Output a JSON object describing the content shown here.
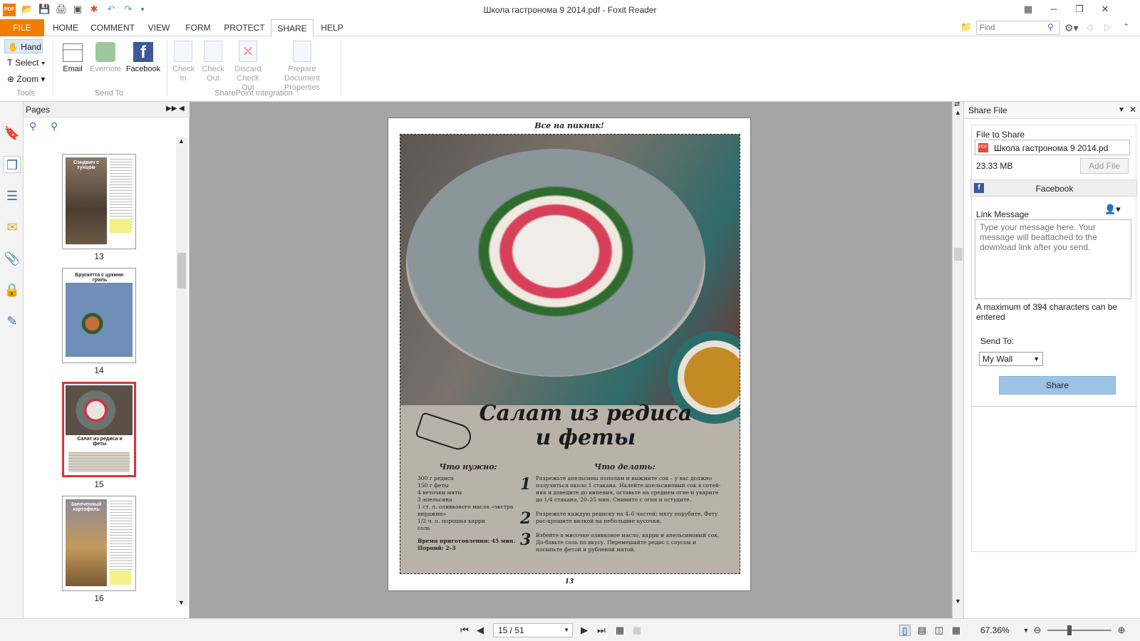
{
  "window": {
    "title": "Школа гастронома 9 2014.pdf - Foxit Reader",
    "app_icon_text": "PDF"
  },
  "menu": {
    "items": [
      "FILE",
      "HOME",
      "COMMENT",
      "VIEW",
      "FORM",
      "PROTECT",
      "SHARE",
      "HELP"
    ],
    "active": "SHARE",
    "find_placeholder": "Find"
  },
  "ribbon": {
    "tools": {
      "hand": "Hand",
      "select": "Select",
      "zoom": "Zoom",
      "group": "Tools"
    },
    "send_to": {
      "email": "Email",
      "evernote": "Evernote",
      "facebook": "Facebook",
      "group": "Send To"
    },
    "sharepoint": {
      "check_in": "Check In",
      "check_out": "Check Out",
      "discard": "Discard Check Out",
      "prepare": "Prepare Document Properties",
      "group": "SharePoint Integration"
    }
  },
  "pages_panel": {
    "title": "Pages",
    "thumbnails": [
      {
        "num": "13",
        "heading": "Сэндвич с тунцом",
        "color": "#5a4a3a"
      },
      {
        "num": "14",
        "heading": "Брускетта с цукини-гриль",
        "color": "#6f8fb8"
      },
      {
        "num": "15",
        "heading": "Салат из редиса и феты",
        "color": "#5f6a62"
      },
      {
        "num": "16",
        "heading": "Запеченный картофель",
        "color": "#9c7f5a"
      }
    ],
    "current": "15"
  },
  "document": {
    "header": "Все на пикник!",
    "title_line1": "Салат из редиса",
    "title_line2": "и феты",
    "ingredients_heading": "Что нужно:",
    "ingredients": [
      "300 г редиса",
      "150 г феты",
      "4 веточки мяты",
      "3 апельсина",
      "1 ст. л. оливкового масла «экстра",
      "вирджин»",
      "1/2 ч. л. порошка карри",
      "соль"
    ],
    "time": "Время приготовления: 45 мин.",
    "portions": "Порций: 2–3",
    "steps_heading": "Что делать:",
    "steps": [
      {
        "n": "1",
        "text": "Разрежьте апельсины пополам и выжмите сок – у вас должно получиться около 1 стакана. Налейте апельсиновый сок в сотей-ник и доведите до кипения, оставьте на среднем огне и уварите до 1/4 стакана, 20–25 мин. Снимите с огня и остудите."
      },
      {
        "n": "2",
        "text": "Разрежьте каждую редиску на 4–6 частей; мяту порубите. Фету рас-крошите вилкой на небольшие кусочки."
      },
      {
        "n": "3",
        "text": "Взбейте в мисочке оливковое масло, карри и апельсиновый сок. До-бавьте соль по вкусу. Перемешайте редис с соусом и посыпьте фетой и рубленой мятой."
      }
    ],
    "page_number": "13"
  },
  "share_panel": {
    "title": "Share File",
    "file_label": "File to Share",
    "file_name": "Школа гастронома 9 2014.pd",
    "file_size": "23.33 MB",
    "add_file": "Add File",
    "service": "Facebook",
    "link_message_label": "Link Message",
    "message_placeholder": "Type your message here. Your message will beattached to the download link after you send.",
    "max_chars": "A maximum of 394 characters can be entered",
    "send_to_label": "Send To:",
    "send_to_value": "My Wall",
    "share_button": "Share"
  },
  "status": {
    "page_value": "15 / 51",
    "zoom": "67.36%"
  },
  "colors": {
    "accent_orange": "#f07d00",
    "share_button": "#9cc3e6",
    "selection_red": "#e0303a"
  }
}
